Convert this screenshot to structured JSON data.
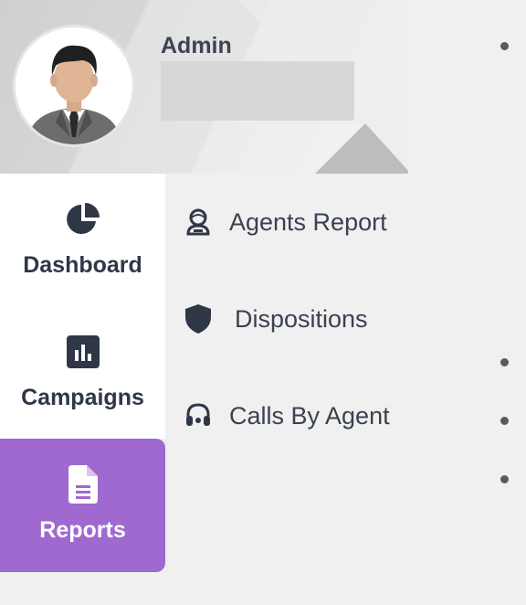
{
  "profile": {
    "name": "Admin",
    "avatar_icon": "user-avatar"
  },
  "nav": {
    "items": [
      {
        "label": "Dashboard",
        "icon": "pie-chart-icon",
        "active": false
      },
      {
        "label": "Campaigns",
        "icon": "bar-chart-icon",
        "active": false
      },
      {
        "label": "Reports",
        "icon": "document-icon",
        "active": true
      }
    ]
  },
  "submenu": {
    "items": [
      {
        "label": "Agents Report",
        "icon": "agent-icon"
      },
      {
        "label": "Dispositions",
        "icon": "shield-icon"
      },
      {
        "label": "Calls By Agent",
        "icon": "headset-icon"
      }
    ]
  },
  "colors": {
    "accent": "#a069d0",
    "text_dark": "#2f3747",
    "background": "#f0f0f0"
  }
}
